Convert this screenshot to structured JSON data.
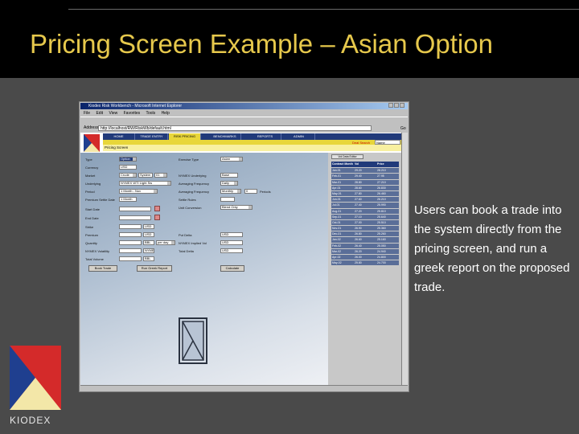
{
  "slide": {
    "title": "Pricing Screen Example – Asian Option",
    "caption": "Users can book a trade into the system directly from the pricing screen, and run a greek report on the proposed trade.",
    "logo_text": "KIODEX",
    "colors": {
      "title": "#e6c84c",
      "background": "#4a4a4a",
      "topbar": "#000000",
      "logo_red": "#d42a2a",
      "logo_blue": "#1f3f8f",
      "logo_yellow": "#f3e7a8"
    }
  },
  "browser": {
    "title": "Kiodex Risk Workbench - Microsoft Internet Explorer",
    "menu": [
      "File",
      "Edit",
      "View",
      "Favorites",
      "Tools",
      "Help"
    ],
    "address_label": "Address",
    "address": "http://localhost/RW/RiskWb/default.html",
    "go": "Go"
  },
  "app": {
    "nav_tabs": [
      "HOME",
      "TRADE ENTRY",
      "RISK PRICING",
      "BENCHMARKS",
      "REPORTS",
      "ADMIN"
    ],
    "active_tab": 2,
    "deal_search_label": "Deal Search",
    "deal_search_value": "Name",
    "screen_label": "Pricing Screen"
  },
  "form": {
    "left_labels": [
      "Type",
      "Currency",
      "Market",
      "Underlying",
      "Period",
      "Premium Settle Date",
      "Start Date",
      "End Date",
      "Strike",
      "Premium",
      "Quantity",
      "NYMEX Volatility",
      "Total Volume"
    ],
    "type": "Option",
    "currency": "USD",
    "market": "Crude",
    "market_ext": "System",
    "market_qty": "01",
    "underlying": "NYMEX WTI Light Sw",
    "period": "1 Month - Nov",
    "premium_settle": "1 Month",
    "strike_unit": "USD",
    "premium_unit": "USD",
    "quantity_unit": "BBL",
    "quantity_freq": "per day",
    "volatility": "NYMEX",
    "total_volume": "BBL",
    "right_labels": [
      "Exercise Type",
      "NYMEX Underlying",
      "Averaging Frequency",
      "Averaging Frequency",
      "Settle Rules",
      "Unit Conversion",
      "Put Delta",
      "NYMEX Implied Vol",
      "Total Delta"
    ],
    "exercise_type": "Asian",
    "nymex_underlying": "Base",
    "avg_freq": "Daily",
    "avg_period": "Monthly",
    "avg_period_value": "0",
    "avg_period_unit": "Periods",
    "unit_conversion": "Blend Only",
    "put_delta": "USD",
    "implied_vol": "USD",
    "total_delta": "USD",
    "btn_book": "Book Trade",
    "btn_greek": "Run Greek Report",
    "btn_calc": "Calculate"
  },
  "right_panel": {
    "header": "Vol Data Editor",
    "columns": [
      "Contract Month",
      "Vol",
      "Price"
    ],
    "rows": [
      [
        "Jan-01",
        "29.20",
        "28.210"
      ],
      [
        "Feb-01",
        "29.40",
        "27.95"
      ],
      [
        "Mar-01",
        "28.80",
        "27.210"
      ],
      [
        "Apr-01",
        "28.60",
        "26.830"
      ],
      [
        "May-01",
        "27.80",
        "26.460"
      ],
      [
        "Jun-01",
        "27.60",
        "26.210"
      ],
      [
        "Jul-01",
        "27.40",
        "25.990"
      ],
      [
        "Aug-01",
        "27.20",
        "25.810"
      ],
      [
        "Sep-01",
        "27.10",
        "25.640"
      ],
      [
        "Oct-01",
        "27.00",
        "25.510"
      ],
      [
        "Nov-01",
        "26.90",
        "25.360"
      ],
      [
        "Dec-01",
        "26.80",
        "25.260"
      ],
      [
        "Jan-02",
        "26.60",
        "25.160"
      ],
      [
        "Feb-02",
        "26.40",
        "25.050"
      ],
      [
        "Mar-02",
        "26.20",
        "24.940"
      ],
      [
        "Apr-02",
        "26.00",
        "24.800"
      ],
      [
        "May-02",
        "25.80",
        "24.700"
      ]
    ]
  }
}
